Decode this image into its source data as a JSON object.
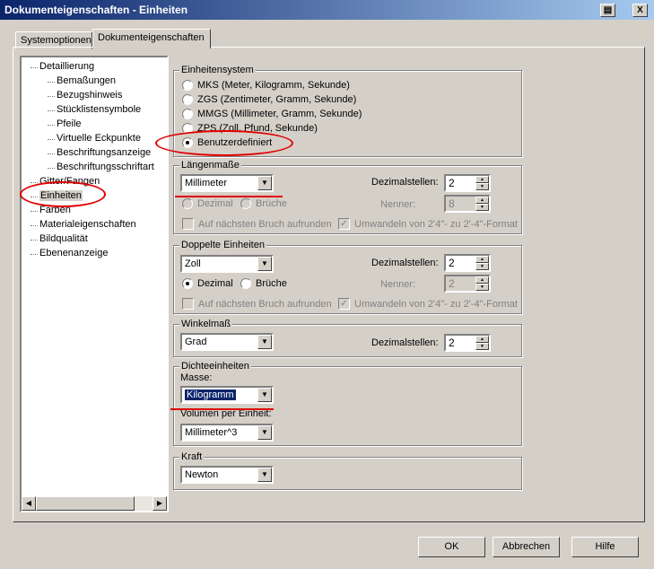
{
  "window": {
    "title": "Dokumenteigenschaften - Einheiten",
    "print_icon": "printer-icon",
    "close_label": "X"
  },
  "tabs": [
    {
      "label": "Systemoptionen"
    },
    {
      "label": "Dokumenteigenschaften",
      "active": true
    }
  ],
  "tree": {
    "items": [
      {
        "label": "Detaillierung",
        "level": 0
      },
      {
        "label": "Bemaßungen",
        "level": 1
      },
      {
        "label": "Bezugshinweis",
        "level": 1
      },
      {
        "label": "Stücklistensymbole",
        "level": 1
      },
      {
        "label": "Pfeile",
        "level": 1
      },
      {
        "label": "Virtuelle Eckpunkte",
        "level": 1
      },
      {
        "label": "Beschriftungsanzeige",
        "level": 1
      },
      {
        "label": "Beschriftungsschriftart",
        "level": 1
      },
      {
        "label": "Gitter/Fangen",
        "level": 0
      },
      {
        "label": "Einheiten",
        "level": 0,
        "selected": true
      },
      {
        "label": "Farben",
        "level": 0
      },
      {
        "label": "Materialeigenschaften",
        "level": 0
      },
      {
        "label": "Bildqualität",
        "level": 0
      },
      {
        "label": "Ebenenanzeige",
        "level": 0
      }
    ]
  },
  "unit_system": {
    "title": "Einheitensystem",
    "options": [
      {
        "label": "MKS  (Meter, Kilogramm, Sekunde)",
        "checked": false
      },
      {
        "label": "ZGS  (Zentimeter, Gramm, Sekunde)",
        "checked": false
      },
      {
        "label": "MMGS (Millimeter, Gramm, Sekunde)",
        "checked": false
      },
      {
        "label": "ZPS  (Zoll, Pfund, Sekunde)",
        "checked": false
      },
      {
        "label": "Benutzerdefiniert",
        "checked": true
      }
    ]
  },
  "length": {
    "title": "Längenmaße",
    "unit": "Millimeter",
    "decimals_label": "Dezimalstellen:",
    "decimals": "2",
    "denominator_label": "Nenner:",
    "denominator": "8",
    "decimal_label": "Dezimal",
    "fraction_label": "Brüche",
    "round_label": "Auf nächsten Bruch aufrunden",
    "convert_label": "Umwandeln von 2'4\"- zu 2'-4\"-Format"
  },
  "dual": {
    "title": "Doppelte Einheiten",
    "unit": "Zoll",
    "decimals_label": "Dezimalstellen:",
    "decimals": "2",
    "denominator_label": "Nenner:",
    "denominator": "2",
    "decimal_label": "Dezimal",
    "fraction_label": "Brüche",
    "round_label": "Auf nächsten Bruch aufrunden",
    "convert_label": "Umwandeln von 2'4\"- zu 2'-4\"-Format"
  },
  "angle": {
    "title": "Winkelmaß",
    "unit": "Grad",
    "decimals_label": "Dezimalstellen:",
    "decimals": "2"
  },
  "density": {
    "title": "Dichteeinheiten",
    "mass_label": "Masse:",
    "mass": "Kilogramm",
    "volume_label": "Volumen per Einheit:",
    "volume": "Millimeter^3"
  },
  "force": {
    "title": "Kraft",
    "unit": "Newton"
  },
  "buttons": {
    "ok": "OK",
    "cancel": "Abbrechen",
    "help": "Hilfe"
  },
  "annotation_color": "#e00000"
}
